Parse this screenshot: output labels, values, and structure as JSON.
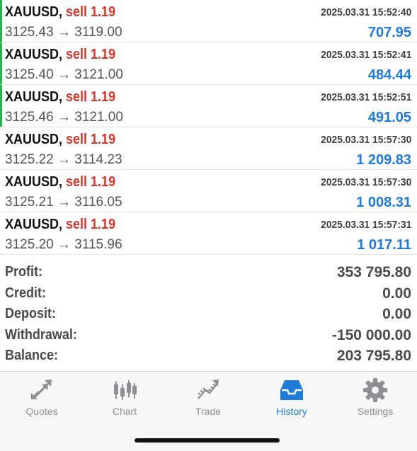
{
  "trades": [
    {
      "symbol": "XAUUSD,",
      "side": "sell 1.19",
      "time": "2025.03.31 15:52:40",
      "open_price": "3125.43",
      "close_price": "3119.00",
      "arrow": "→",
      "profit": "707.95",
      "marker": "#2ab34a"
    },
    {
      "symbol": "XAUUSD,",
      "side": "sell 1.19",
      "time": "2025.03.31 15:52:41",
      "open_price": "3125.40",
      "close_price": "3121.00",
      "arrow": "→",
      "profit": "484.44",
      "marker": "#2ab34a"
    },
    {
      "symbol": "XAUUSD,",
      "side": "sell 1.19",
      "time": "2025.03.31 15:52:51",
      "open_price": "3125.46",
      "close_price": "3121.00",
      "arrow": "→",
      "profit": "491.05",
      "marker": "#2ab34a"
    },
    {
      "symbol": "XAUUSD,",
      "side": "sell 1.19",
      "time": "2025.03.31 15:57:30",
      "open_price": "3125.22",
      "close_price": "3114.23",
      "arrow": "→",
      "profit": "1 209.83",
      "marker": "#ffffff"
    },
    {
      "symbol": "XAUUSD,",
      "side": "sell 1.19",
      "time": "2025.03.31 15:57:30",
      "open_price": "3125.21",
      "close_price": "3116.05",
      "arrow": "→",
      "profit": "1 008.31",
      "marker": "#ffffff"
    },
    {
      "symbol": "XAUUSD,",
      "side": "sell 1.19",
      "time": "2025.03.31 15:57:31",
      "open_price": "3125.20",
      "close_price": "3115.96",
      "arrow": "→",
      "profit": "1 017.11",
      "marker": "#ffffff"
    }
  ],
  "summary": {
    "profit": {
      "label": "Profit:",
      "value": "353 795.80"
    },
    "credit": {
      "label": "Credit:",
      "value": "0.00"
    },
    "deposit": {
      "label": "Deposit:",
      "value": "0.00"
    },
    "withdrawal": {
      "label": "Withdrawal:",
      "value": "-150 000.00"
    },
    "balance": {
      "label": "Balance:",
      "value": "203 795.80"
    }
  },
  "tabbar": {
    "quotes": {
      "label": "Quotes",
      "icon": "quotes-arrows-icon"
    },
    "chart": {
      "label": "Chart",
      "icon": "candlestick-icon"
    },
    "trade": {
      "label": "Trade",
      "icon": "trade-trend-icon"
    },
    "history": {
      "label": "History",
      "icon": "inbox-tray-icon",
      "active": true
    },
    "settings": {
      "label": "Settings",
      "icon": "gear-icon"
    }
  },
  "colors": {
    "accent": "#1f7ad8",
    "sell": "#d8362a",
    "open_marker": "#2ab34a",
    "inactive_tab": "#8e8e93"
  }
}
